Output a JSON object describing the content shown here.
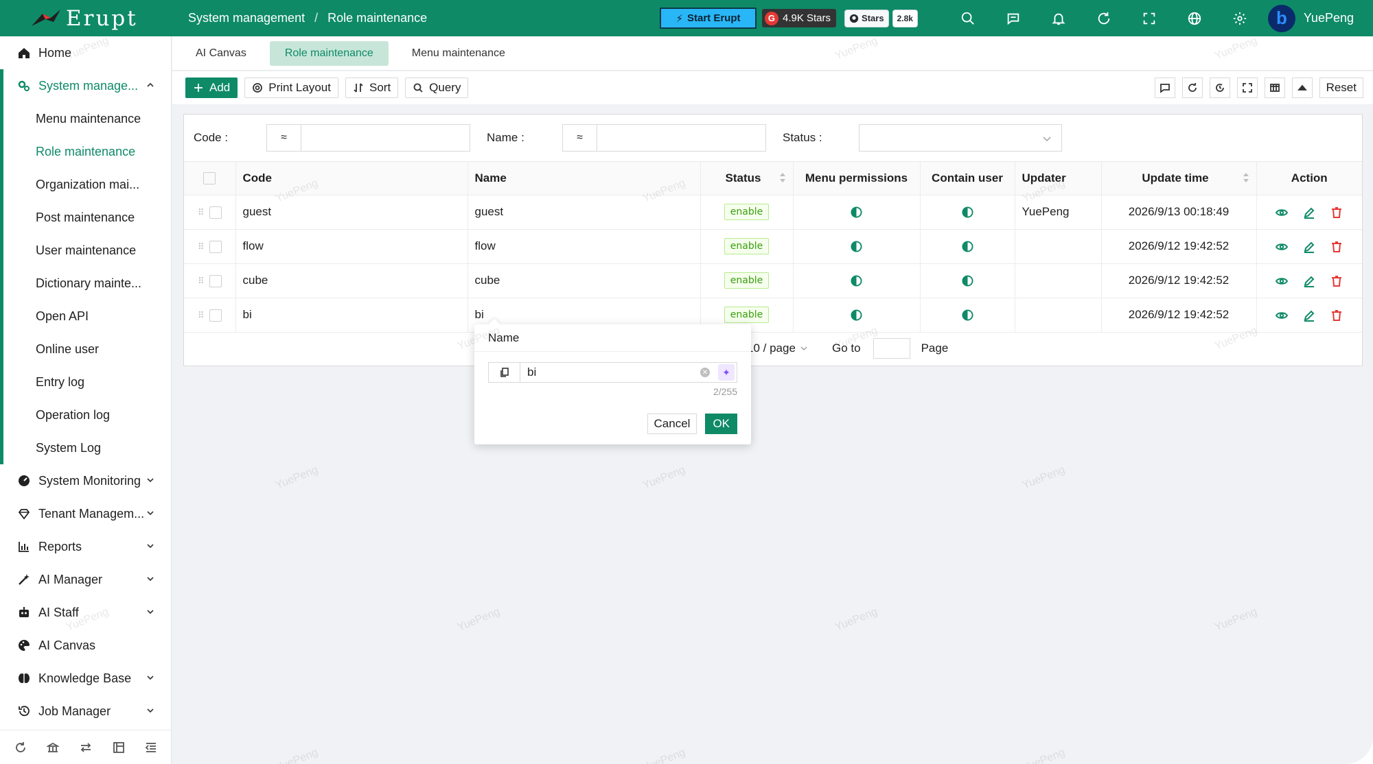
{
  "app": {
    "logo_text": "Erupt"
  },
  "breadcrumb": [
    "System management",
    "Role maintenance"
  ],
  "header": {
    "start_label": "Start Erupt",
    "gitee_stars": "4.9K Stars",
    "github_label": "Stars",
    "github_count": "2.8k",
    "user_name": "YuePeng",
    "icons": [
      "search-icon",
      "chat-icon",
      "bell-icon",
      "refresh-icon",
      "fullscreen-icon",
      "globe-icon",
      "gear-icon"
    ]
  },
  "sidebar": {
    "home": "Home",
    "system_management": "System manage...",
    "sub_items": [
      "Menu maintenance",
      "Role maintenance",
      "Organization mai...",
      "Post maintenance",
      "User maintenance",
      "Dictionary mainte...",
      "Open API",
      "Online user",
      "Entry log",
      "Operation log",
      "System Log"
    ],
    "groups": [
      "System Monitoring",
      "Tenant Managem...",
      "Reports",
      "AI Manager",
      "AI Staff",
      "AI Canvas",
      "Knowledge Base",
      "Job Manager"
    ]
  },
  "tabs": [
    "AI Canvas",
    "Role maintenance",
    "Menu maintenance"
  ],
  "toolbar": {
    "add": "Add",
    "print_layout": "Print Layout",
    "sort": "Sort",
    "query": "Query",
    "reset": "Reset"
  },
  "filters": {
    "code_label": "Code :",
    "name_label": "Name :",
    "status_label": "Status :",
    "approx": "≈"
  },
  "table": {
    "columns": [
      "Code",
      "Name",
      "Status",
      "Menu permissions",
      "Contain user",
      "Updater",
      "Update time",
      "Action"
    ],
    "rows": [
      {
        "code": "guest",
        "name": "guest",
        "status": "enable",
        "updater": "YuePeng",
        "update_time": "2026/9/13 00:18:49"
      },
      {
        "code": "flow",
        "name": "flow",
        "status": "enable",
        "updater": "",
        "update_time": "2026/9/12 19:42:52"
      },
      {
        "code": "cube",
        "name": "cube",
        "status": "enable",
        "updater": "",
        "update_time": "2026/9/12 19:42:52"
      },
      {
        "code": "bi",
        "name": "bi",
        "status": "enable",
        "updater": "",
        "update_time": "2026/9/12 19:42:52"
      }
    ]
  },
  "pagination": {
    "page_size": "10 / page",
    "goto_label": "Go to",
    "page_label": "Page"
  },
  "popover": {
    "title": "Name",
    "value": "bi",
    "counter": "2/255",
    "cancel": "Cancel",
    "ok": "OK"
  },
  "watermark": "YuePeng",
  "colors": {
    "brand": "#0e8a67",
    "start_button": "#29b6f6",
    "delete": "#e53935",
    "tag_green": "#389e0d"
  }
}
